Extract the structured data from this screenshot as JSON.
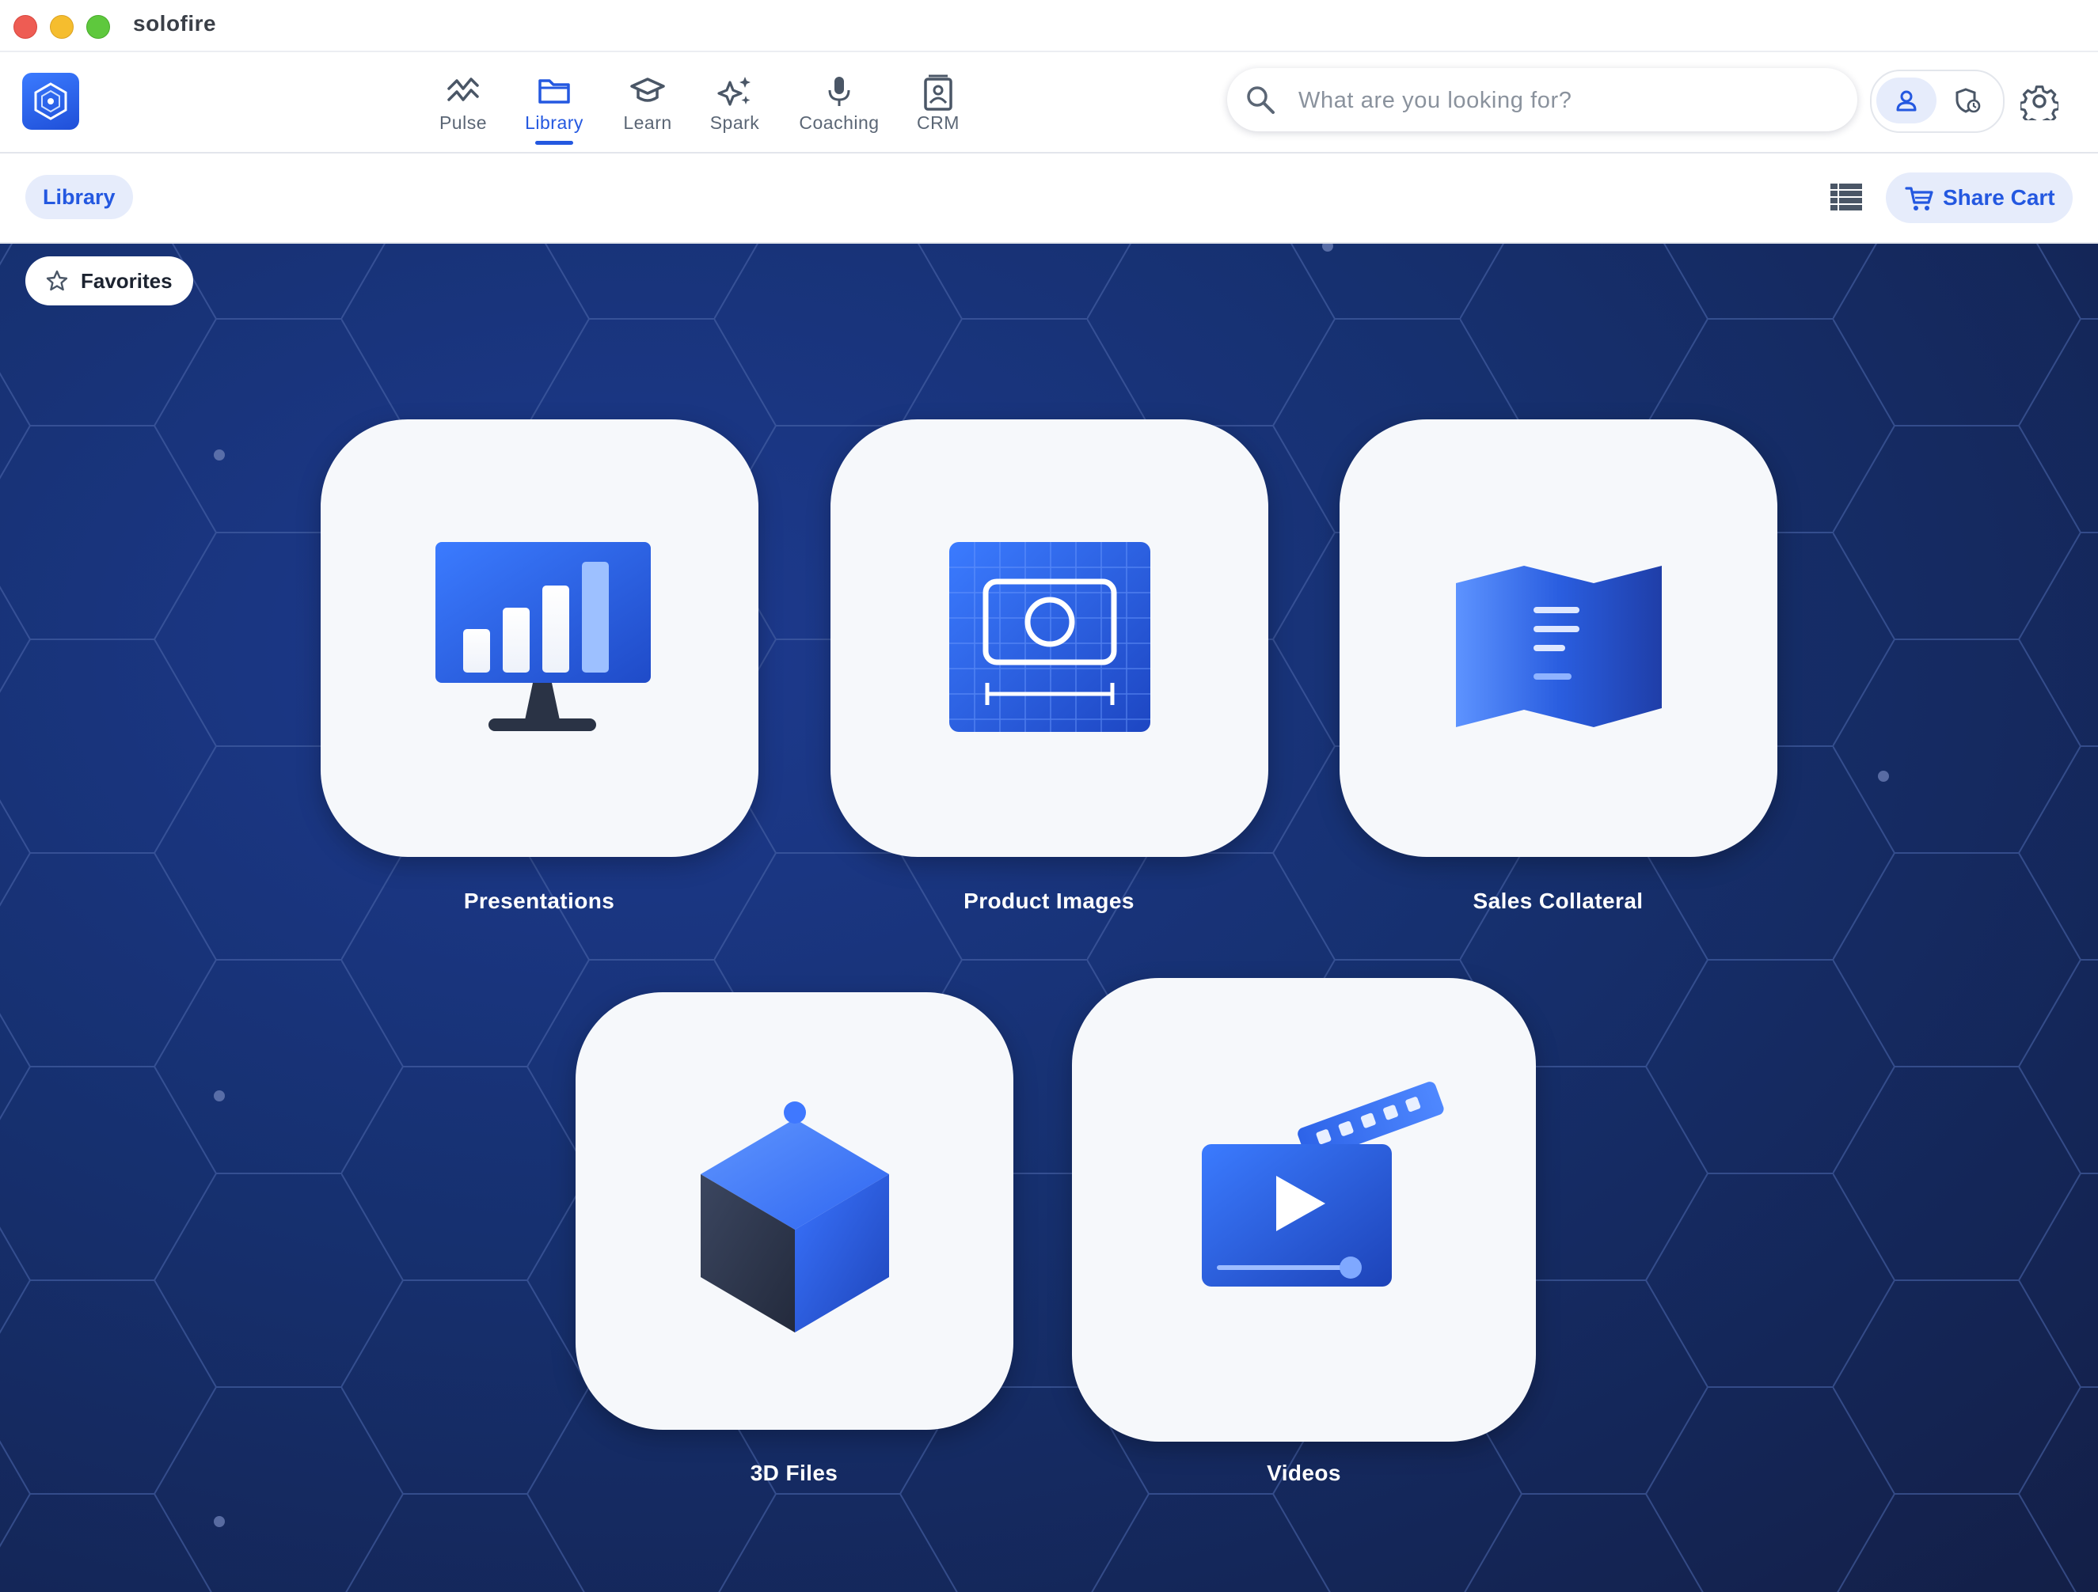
{
  "window": {
    "title": "solofire"
  },
  "nav": {
    "items": [
      {
        "label": "Pulse",
        "icon": "pulse-icon"
      },
      {
        "label": "Library",
        "icon": "folder-icon",
        "active": true
      },
      {
        "label": "Learn",
        "icon": "graduation-cap-icon"
      },
      {
        "label": "Spark",
        "icon": "sparkles-icon"
      },
      {
        "label": "Coaching",
        "icon": "microphone-icon"
      },
      {
        "label": "CRM",
        "icon": "contact-book-icon"
      }
    ]
  },
  "search": {
    "placeholder": "What are you looking for?",
    "value": ""
  },
  "toolbar": {
    "breadcrumb": "Library",
    "share_cart_label": "Share Cart"
  },
  "main": {
    "favorites_label": "Favorites",
    "tiles": [
      {
        "label": "Presentations",
        "icon": "presentation-monitor-icon"
      },
      {
        "label": "Product Images",
        "icon": "product-image-icon"
      },
      {
        "label": "Sales Collateral",
        "icon": "brochure-icon"
      },
      {
        "label": "3D Files",
        "icon": "cube-icon"
      },
      {
        "label": "Videos",
        "icon": "video-clapper-icon"
      }
    ]
  },
  "colors": {
    "accent": "#2458e0",
    "accent_light": "#e6ecfb",
    "background_dark": "#131f47",
    "background_mid": "#1d3a8f",
    "tile": "#f6f8fb"
  }
}
